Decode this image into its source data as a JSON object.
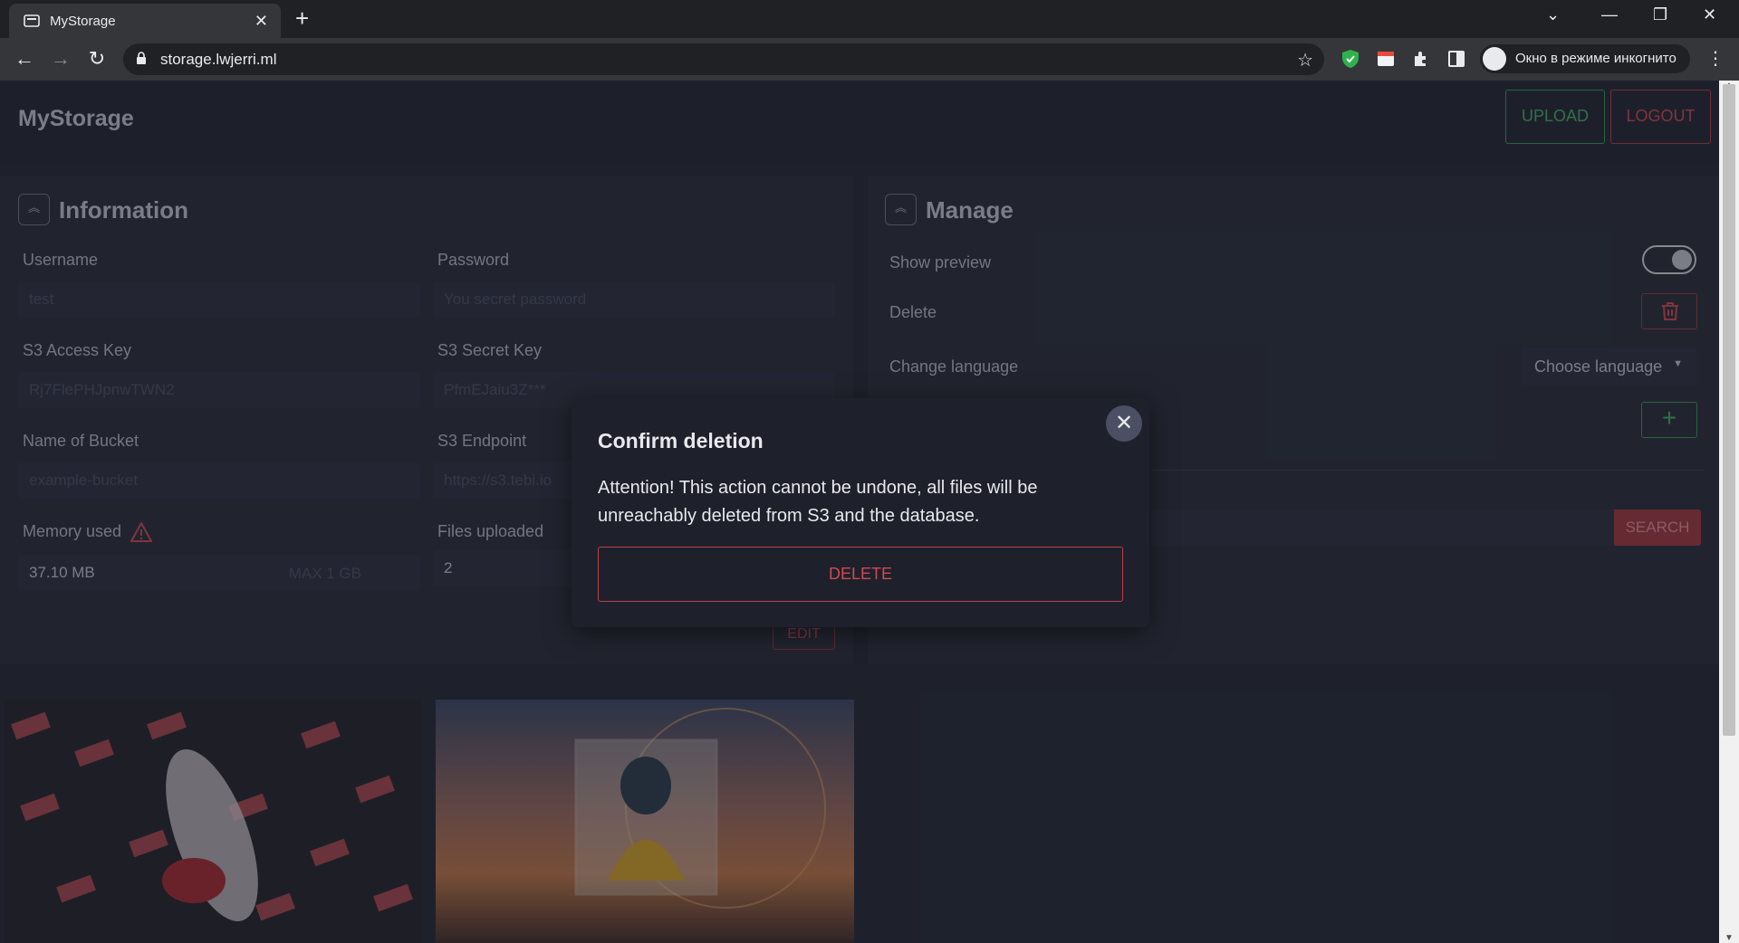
{
  "browser": {
    "tab_title": "MyStorage",
    "tab_close": "✕",
    "new_tab": "+",
    "url": "storage.lwjerri.ml",
    "incognito_label": "Окно в режиме инкогнито"
  },
  "header": {
    "brand": "MyStorage",
    "upload_label": "UPLOAD",
    "logout_label": "LOGOUT"
  },
  "information": {
    "title": "Information",
    "username_label": "Username",
    "username_placeholder": "test",
    "password_label": "Password",
    "password_placeholder": "You secret password",
    "access_key_label": "S3 Access Key",
    "access_key_value": "Rj7FlePHJpnwTWN2",
    "secret_key_label": "S3 Secret Key",
    "secret_key_value": "PfmEJaiu3Z***",
    "bucket_label": "Name of Bucket",
    "bucket_placeholder": "example-bucket",
    "endpoint_label": "S3 Endpoint",
    "endpoint_placeholder": "https://s3.tebi.io",
    "memory_label": "Memory used",
    "memory_value": "37.10 MB",
    "memory_max": "MAX 1 GB",
    "files_label": "Files uploaded",
    "files_value": "2",
    "edit_label": "EDIT"
  },
  "manage": {
    "title": "Manage",
    "show_preview_label": "Show preview",
    "show_preview_on": true,
    "delete_label": "Delete",
    "change_language_label": "Change language",
    "language_dropdown": "Choose language",
    "add_label": "+",
    "search_label": "SEARCH"
  },
  "modal": {
    "title": "Confirm deletion",
    "body": "Attention! This action cannot be undone, all files will be unreachably deleted from S3 and the database.",
    "delete_label": "DELETE",
    "close": "✕"
  },
  "colors": {
    "accent_green": "#45b267",
    "accent_red": "#d04a52",
    "background": "#262a36"
  }
}
